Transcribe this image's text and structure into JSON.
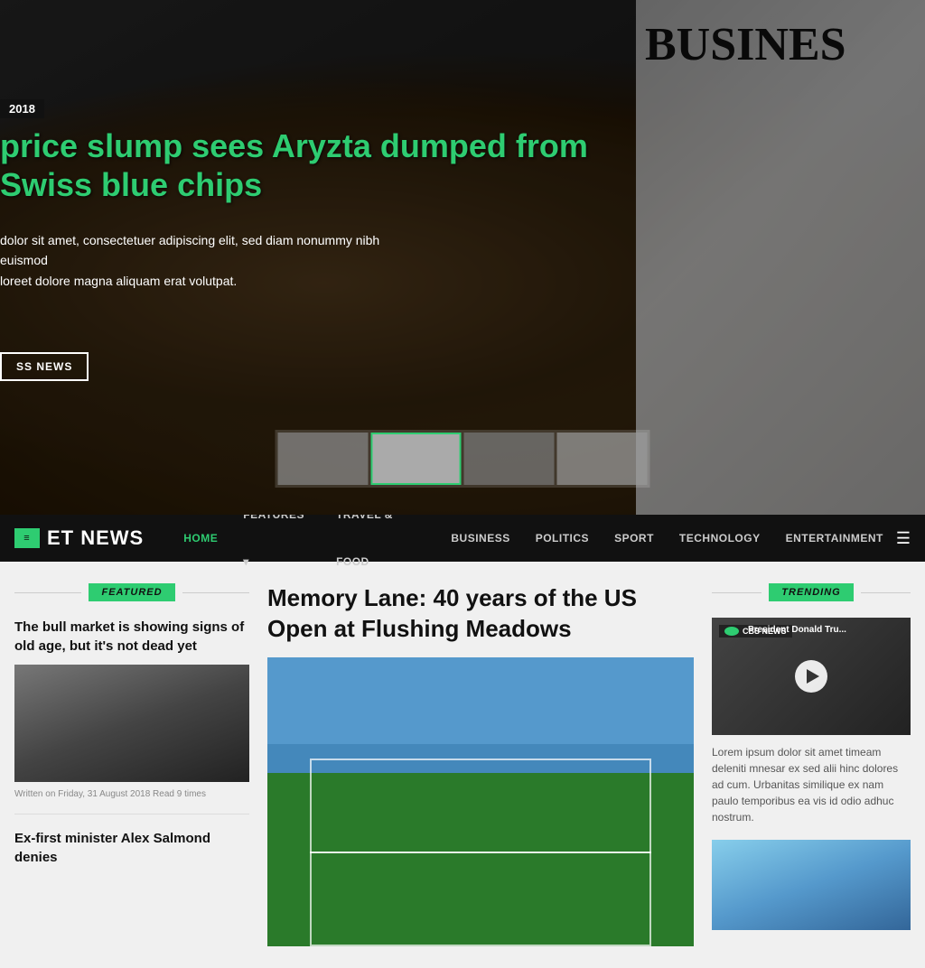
{
  "hero": {
    "date": "2018",
    "title": "price slump sees Aryzta dumped from Swiss blue chips",
    "excerpt_line1": "dolor sit amet, consectetuer adipiscing elit, sed diam nonummy nibh euismod",
    "excerpt_line2": "loreet dolore magna aliquam erat volutpat.",
    "read_more_label": "SS NEWS",
    "newspaper_headline": "BUSINES"
  },
  "nav": {
    "logo_text": "ET NEWS",
    "items": [
      {
        "label": "HOME",
        "active": true
      },
      {
        "label": "FEATURES",
        "dropdown": true
      },
      {
        "label": "TRAVEL & FOOD",
        "active": false
      },
      {
        "label": "BUSINESS",
        "active": false
      },
      {
        "label": "POLITICS",
        "active": false
      },
      {
        "label": "SPORT",
        "active": false
      },
      {
        "label": "TECHNOLOGY",
        "active": false
      },
      {
        "label": "ENTERTAINMENT",
        "active": false
      }
    ]
  },
  "featured": {
    "header": "FEATURED",
    "article1": {
      "title": "The bull market is showing signs of old age, but it's not dead yet",
      "meta": "Written on Friday, 31 August 2018 Read 9 times"
    },
    "article2": {
      "title": "Ex-first minister Alex Salmond denies"
    }
  },
  "center": {
    "title": "Memory Lane: 40 years of the US Open at Flushing Meadows"
  },
  "trending": {
    "header": "TRENDING",
    "video": {
      "badge": "CBS NEWS",
      "title": "President Donald Tru...",
      "title_full": "President Donald Tru _"
    },
    "desc": "Lorem ipsum dolor sit amet timeam deleniti mnesar ex sed alii hinc dolores ad cum. Urbanitas similique ex nam paulo temporibus ea vis id odio adhuc nostrum."
  }
}
